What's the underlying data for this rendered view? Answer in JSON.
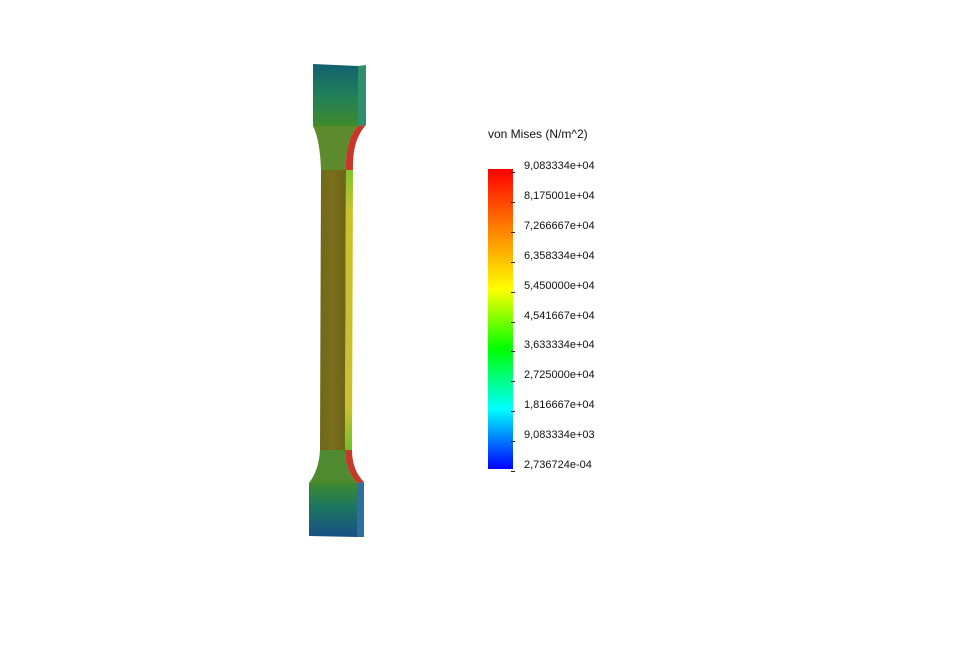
{
  "legend": {
    "title": "von Mises (N/m^2)",
    "ticks": [
      "9,083334e+04",
      "8,175001e+04",
      "7,266667e+04",
      "6,358334e+04",
      "5,450000e+04",
      "4,541667e+04",
      "3,633334e+04",
      "2,725000e+04",
      "1,816667e+04",
      "9,083334e+03",
      "2,736724e-04"
    ],
    "colors": [
      "#ff0000",
      "#ff7f00",
      "#ffff00",
      "#00ff00",
      "#00ffff",
      "#0000ff"
    ]
  },
  "model": {
    "name": "tensile-specimen",
    "colors": {
      "shaft": "#7a6e1c",
      "side_face": "#c9bc2e",
      "grip": "#1a7a6a",
      "hot_spot": "#d82020"
    }
  }
}
